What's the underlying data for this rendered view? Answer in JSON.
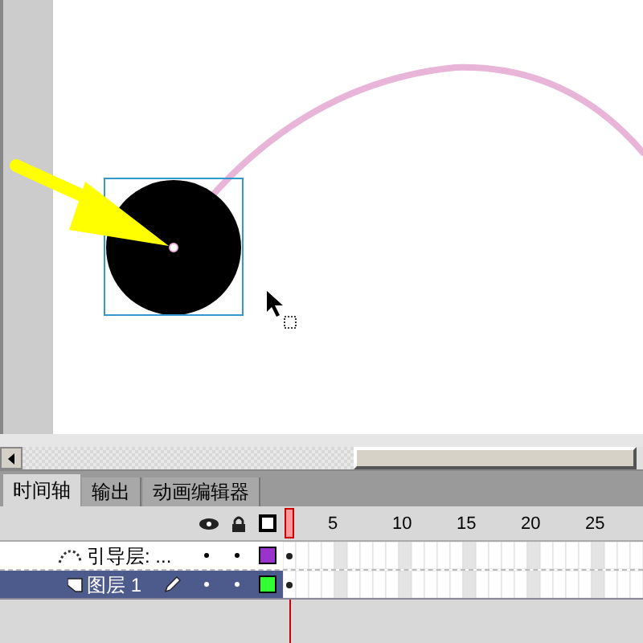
{
  "tabs": [
    {
      "label": "时间轴",
      "selected": true
    },
    {
      "label": "输出",
      "selected": false
    },
    {
      "label": "动画编辑器",
      "selected": false
    }
  ],
  "ruler": [
    "5",
    "10",
    "15",
    "20",
    "25"
  ],
  "layers": [
    {
      "kind": "guide",
      "name": "引导层: ...",
      "selected": false,
      "editing": false,
      "color": "#9933cc"
    },
    {
      "kind": "normal",
      "name": "图层 1",
      "selected": true,
      "editing": true,
      "color": "#33ff33"
    }
  ]
}
